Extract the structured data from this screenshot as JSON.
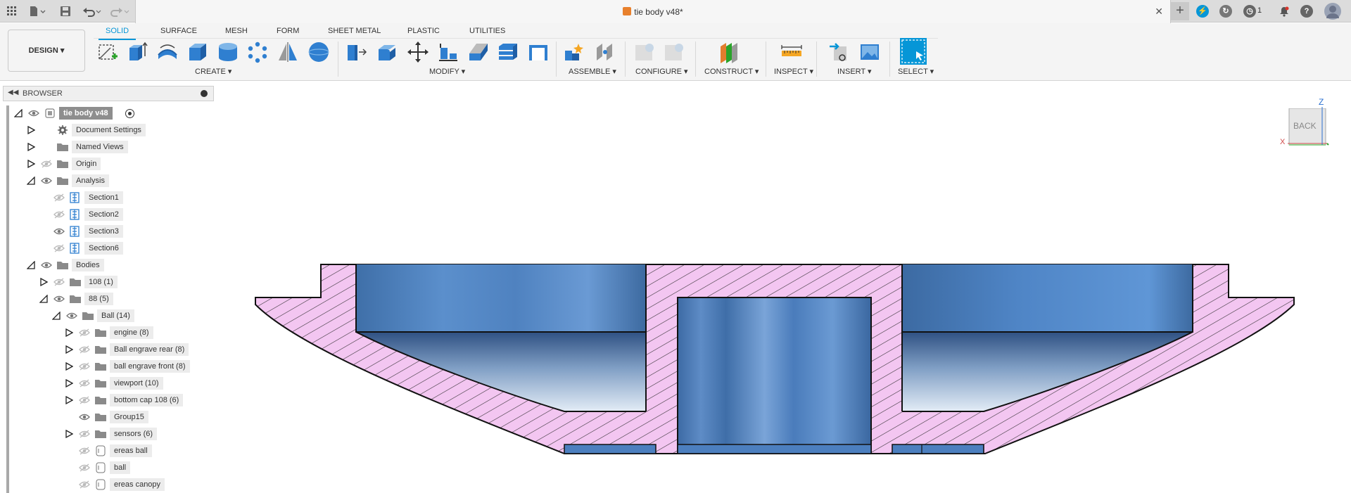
{
  "app": {
    "document_title": "tie body v48*",
    "job_count": "1"
  },
  "ribbon": {
    "workspace": "DESIGN",
    "tabs": [
      {
        "label": "SOLID",
        "active": true
      },
      {
        "label": "SURFACE",
        "active": false
      },
      {
        "label": "MESH",
        "active": false
      },
      {
        "label": "FORM",
        "active": false
      },
      {
        "label": "SHEET METAL",
        "active": false
      },
      {
        "label": "PLASTIC",
        "active": false
      },
      {
        "label": "UTILITIES",
        "active": false
      }
    ],
    "groups": [
      {
        "label": "CREATE ▾"
      },
      {
        "label": "MODIFY ▾"
      },
      {
        "label": "ASSEMBLE ▾"
      },
      {
        "label": "CONFIGURE ▾"
      },
      {
        "label": "CONSTRUCT ▾"
      },
      {
        "label": "INSPECT ▾"
      },
      {
        "label": "INSERT ▾"
      },
      {
        "label": "SELECT ▾"
      }
    ],
    "accent": "#0696d7"
  },
  "browser": {
    "title": "BROWSER",
    "nodes": [
      {
        "label": "tie body v48",
        "twisty": "open",
        "eye": "visible",
        "icon": "document-icon",
        "depth": 0,
        "style": "root"
      },
      {
        "label": "Document Settings",
        "twisty": "closed",
        "eye": "none",
        "icon": "gear-icon",
        "depth": 1,
        "style": "boxed"
      },
      {
        "label": "Named Views",
        "twisty": "closed",
        "eye": "none",
        "icon": "folder-icon",
        "depth": 1,
        "style": "boxed"
      },
      {
        "label": "Origin",
        "twisty": "closed",
        "eye": "hidden",
        "icon": "folder-icon",
        "depth": 1,
        "style": "boxed"
      },
      {
        "label": "Analysis",
        "twisty": "open",
        "eye": "visible",
        "icon": "folder-icon",
        "depth": 1,
        "style": "boxed"
      },
      {
        "label": "Section1",
        "twisty": "none",
        "eye": "hidden",
        "icon": "section-icon",
        "depth": 2,
        "style": "boxed"
      },
      {
        "label": "Section2",
        "twisty": "none",
        "eye": "hidden",
        "icon": "section-icon",
        "depth": 2,
        "style": "boxed"
      },
      {
        "label": "Section3",
        "twisty": "none",
        "eye": "visible",
        "icon": "section-icon",
        "depth": 2,
        "style": "boxed"
      },
      {
        "label": "Section6",
        "twisty": "none",
        "eye": "hidden",
        "icon": "section-icon",
        "depth": 2,
        "style": "boxed"
      },
      {
        "label": "Bodies",
        "twisty": "open",
        "eye": "visible",
        "icon": "folder-icon",
        "depth": 1,
        "style": "boxed"
      },
      {
        "label": "108 (1)",
        "twisty": "closed",
        "eye": "hidden",
        "icon": "folder-icon",
        "depth": 2,
        "style": "boxed"
      },
      {
        "label": "88 (5)",
        "twisty": "open",
        "eye": "visible",
        "icon": "folder-icon",
        "depth": 2,
        "style": "boxed"
      },
      {
        "label": "Ball (14)",
        "twisty": "open",
        "eye": "visible",
        "icon": "folder-icon",
        "depth": 3,
        "style": "boxed"
      },
      {
        "label": "engine (8)",
        "twisty": "closed",
        "eye": "hidden",
        "icon": "folder-icon",
        "depth": 4,
        "style": "boxed"
      },
      {
        "label": "Ball engrave rear (8)",
        "twisty": "closed",
        "eye": "hidden",
        "icon": "folder-icon",
        "depth": 4,
        "style": "boxed"
      },
      {
        "label": "ball engrave front (8)",
        "twisty": "closed",
        "eye": "hidden",
        "icon": "folder-icon",
        "depth": 4,
        "style": "boxed"
      },
      {
        "label": "viewport (10)",
        "twisty": "closed",
        "eye": "hidden",
        "icon": "folder-icon",
        "depth": 4,
        "style": "boxed"
      },
      {
        "label": "bottom cap 108 (6)",
        "twisty": "closed",
        "eye": "hidden",
        "icon": "folder-icon",
        "depth": 4,
        "style": "boxed"
      },
      {
        "label": "Group15",
        "twisty": "none",
        "eye": "visible",
        "icon": "folder-icon",
        "depth": 4,
        "style": "boxed"
      },
      {
        "label": "sensors (6)",
        "twisty": "closed",
        "eye": "hidden",
        "icon": "folder-icon",
        "depth": 4,
        "style": "boxed"
      },
      {
        "label": "ereas ball",
        "twisty": "none",
        "eye": "hidden",
        "icon": "body-icon",
        "depth": 4,
        "style": "boxed"
      },
      {
        "label": "ball",
        "twisty": "none",
        "eye": "hidden",
        "icon": "body-icon",
        "depth": 4,
        "style": "boxed"
      },
      {
        "label": "ereas canopy",
        "twisty": "none",
        "eye": "hidden",
        "icon": "body-icon",
        "depth": 4,
        "style": "boxed"
      }
    ]
  },
  "viewcube": {
    "face": "BACK",
    "axis_z": "Z",
    "axis_x": "X"
  },
  "colors": {
    "section_fill": "#f3c6f1",
    "section_hatch": "#2a2a2a",
    "body_blue": "#4f86c6"
  }
}
